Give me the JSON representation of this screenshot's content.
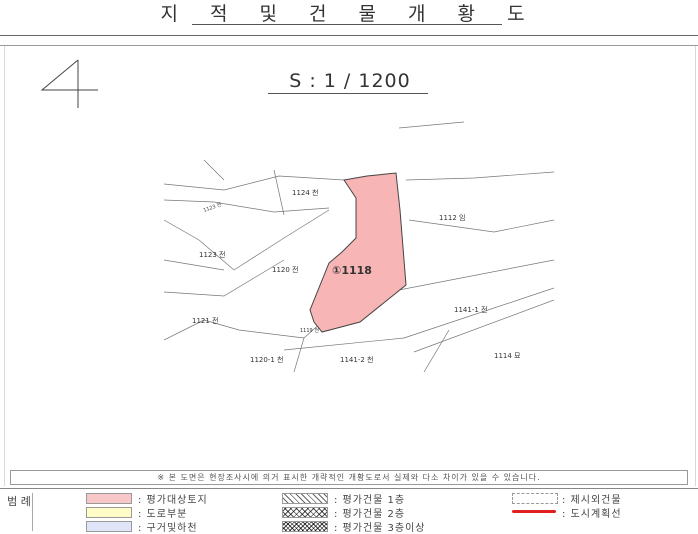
{
  "title": "지 적 및 건 물 개 황 도",
  "sheet_number": "4",
  "scale": "S : 1 / 1200",
  "map": {
    "subject_lot": "①1118",
    "parcels": [
      "1124 천",
      "1112 임",
      "1123 전",
      "1120 전",
      "1121 전",
      "1141-1 전",
      "1120-1 천",
      "1141-2 천",
      "1114 묘",
      "1123 전",
      "1119 천"
    ],
    "colors": {
      "subject_fill": "#f8b5b5",
      "subject_stroke": "#444444",
      "subject_label": "#e02020"
    }
  },
  "notice": "※ 본 도면은 현장조사시에 의거 표시한 개략적인 개황도로서 실제와 다소 차이가 있을 수 있습니다.",
  "legend": {
    "heading": "범 례",
    "items": [
      {
        "label": ": 평가대상토지",
        "color": "#f8c8c8"
      },
      {
        "label": ": 도로부분",
        "color": "#fffcc8"
      },
      {
        "label": ": 구거및하천",
        "color": "#dfe4f8"
      },
      {
        "label": ": 평가건물 1층"
      },
      {
        "label": ": 평가건물 2층"
      },
      {
        "label": ": 평가건물 3층이상"
      },
      {
        "label": ": 제시외건물"
      },
      {
        "label": ": 도시계획선",
        "color": "#e02020"
      }
    ]
  }
}
